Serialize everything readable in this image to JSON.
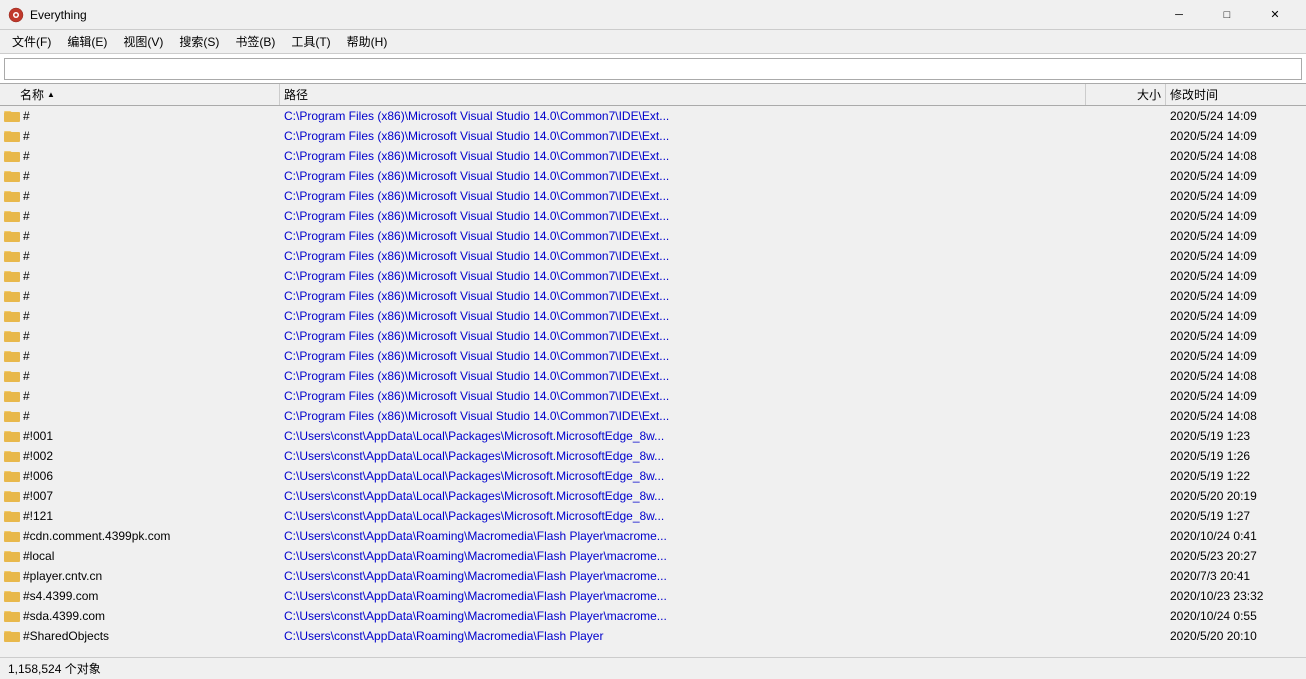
{
  "titleBar": {
    "appName": "Everything",
    "minBtn": "─",
    "maxBtn": "□",
    "closeBtn": "✕"
  },
  "menuBar": {
    "items": [
      {
        "label": "文件(F)"
      },
      {
        "label": "编辑(E)"
      },
      {
        "label": "视图(V)"
      },
      {
        "label": "搜索(S)"
      },
      {
        "label": "书签(B)"
      },
      {
        "label": "工具(T)"
      },
      {
        "label": "帮助(H)"
      }
    ]
  },
  "searchBar": {
    "placeholder": "",
    "value": ""
  },
  "tableHeader": {
    "nameCol": "名称",
    "pathCol": "路径",
    "sizeCol": "大小",
    "modifiedCol": "修改时间"
  },
  "rows": [
    {
      "name": "#",
      "path": "C:\\Program Files (x86)\\Microsoft Visual Studio 14.0\\Common7\\IDE\\Ext...",
      "size": "",
      "modified": "2020/5/24 14:09"
    },
    {
      "name": "#",
      "path": "C:\\Program Files (x86)\\Microsoft Visual Studio 14.0\\Common7\\IDE\\Ext...",
      "size": "",
      "modified": "2020/5/24 14:09"
    },
    {
      "name": "#",
      "path": "C:\\Program Files (x86)\\Microsoft Visual Studio 14.0\\Common7\\IDE\\Ext...",
      "size": "",
      "modified": "2020/5/24 14:08"
    },
    {
      "name": "#",
      "path": "C:\\Program Files (x86)\\Microsoft Visual Studio 14.0\\Common7\\IDE\\Ext...",
      "size": "",
      "modified": "2020/5/24 14:09"
    },
    {
      "name": "#",
      "path": "C:\\Program Files (x86)\\Microsoft Visual Studio 14.0\\Common7\\IDE\\Ext...",
      "size": "",
      "modified": "2020/5/24 14:09"
    },
    {
      "name": "#",
      "path": "C:\\Program Files (x86)\\Microsoft Visual Studio 14.0\\Common7\\IDE\\Ext...",
      "size": "",
      "modified": "2020/5/24 14:09"
    },
    {
      "name": "#",
      "path": "C:\\Program Files (x86)\\Microsoft Visual Studio 14.0\\Common7\\IDE\\Ext...",
      "size": "",
      "modified": "2020/5/24 14:09"
    },
    {
      "name": "#",
      "path": "C:\\Program Files (x86)\\Microsoft Visual Studio 14.0\\Common7\\IDE\\Ext...",
      "size": "",
      "modified": "2020/5/24 14:09"
    },
    {
      "name": "#",
      "path": "C:\\Program Files (x86)\\Microsoft Visual Studio 14.0\\Common7\\IDE\\Ext...",
      "size": "",
      "modified": "2020/5/24 14:09"
    },
    {
      "name": "#",
      "path": "C:\\Program Files (x86)\\Microsoft Visual Studio 14.0\\Common7\\IDE\\Ext...",
      "size": "",
      "modified": "2020/5/24 14:09"
    },
    {
      "name": "#",
      "path": "C:\\Program Files (x86)\\Microsoft Visual Studio 14.0\\Common7\\IDE\\Ext...",
      "size": "",
      "modified": "2020/5/24 14:09"
    },
    {
      "name": "#",
      "path": "C:\\Program Files (x86)\\Microsoft Visual Studio 14.0\\Common7\\IDE\\Ext...",
      "size": "",
      "modified": "2020/5/24 14:09"
    },
    {
      "name": "#",
      "path": "C:\\Program Files (x86)\\Microsoft Visual Studio 14.0\\Common7\\IDE\\Ext...",
      "size": "",
      "modified": "2020/5/24 14:09"
    },
    {
      "name": "#",
      "path": "C:\\Program Files (x86)\\Microsoft Visual Studio 14.0\\Common7\\IDE\\Ext...",
      "size": "",
      "modified": "2020/5/24 14:08"
    },
    {
      "name": "#",
      "path": "C:\\Program Files (x86)\\Microsoft Visual Studio 14.0\\Common7\\IDE\\Ext...",
      "size": "",
      "modified": "2020/5/24 14:09"
    },
    {
      "name": "#",
      "path": "C:\\Program Files (x86)\\Microsoft Visual Studio 14.0\\Common7\\IDE\\Ext...",
      "size": "",
      "modified": "2020/5/24 14:08"
    },
    {
      "name": "#!001",
      "path": "C:\\Users\\const\\AppData\\Local\\Packages\\Microsoft.MicrosoftEdge_8w...",
      "size": "",
      "modified": "2020/5/19 1:23"
    },
    {
      "name": "#!002",
      "path": "C:\\Users\\const\\AppData\\Local\\Packages\\Microsoft.MicrosoftEdge_8w...",
      "size": "",
      "modified": "2020/5/19 1:26"
    },
    {
      "name": "#!006",
      "path": "C:\\Users\\const\\AppData\\Local\\Packages\\Microsoft.MicrosoftEdge_8w...",
      "size": "",
      "modified": "2020/5/19 1:22"
    },
    {
      "name": "#!007",
      "path": "C:\\Users\\const\\AppData\\Local\\Packages\\Microsoft.MicrosoftEdge_8w...",
      "size": "",
      "modified": "2020/5/20 20:19"
    },
    {
      "name": "#!121",
      "path": "C:\\Users\\const\\AppData\\Local\\Packages\\Microsoft.MicrosoftEdge_8w...",
      "size": "",
      "modified": "2020/5/19 1:27"
    },
    {
      "name": "#cdn.comment.4399pk.com",
      "path": "C:\\Users\\const\\AppData\\Roaming\\Macromedia\\Flash Player\\macrome...",
      "size": "",
      "modified": "2020/10/24 0:41"
    },
    {
      "name": "#local",
      "path": "C:\\Users\\const\\AppData\\Roaming\\Macromedia\\Flash Player\\macrome...",
      "size": "",
      "modified": "2020/5/23 20:27"
    },
    {
      "name": "#player.cntv.cn",
      "path": "C:\\Users\\const\\AppData\\Roaming\\Macromedia\\Flash Player\\macrome...",
      "size": "",
      "modified": "2020/7/3 20:41"
    },
    {
      "name": "#s4.4399.com",
      "path": "C:\\Users\\const\\AppData\\Roaming\\Macromedia\\Flash Player\\macrome...",
      "size": "",
      "modified": "2020/10/23 23:32"
    },
    {
      "name": "#sda.4399.com",
      "path": "C:\\Users\\const\\AppData\\Roaming\\Macromedia\\Flash Player\\macrome...",
      "size": "",
      "modified": "2020/10/24 0:55"
    },
    {
      "name": "#SharedObjects",
      "path": "C:\\Users\\const\\AppData\\Roaming\\Macromedia\\Flash Player",
      "size": "",
      "modified": "2020/5/20 20:10"
    }
  ],
  "statusBar": {
    "text": "1,158,524 个对象"
  }
}
